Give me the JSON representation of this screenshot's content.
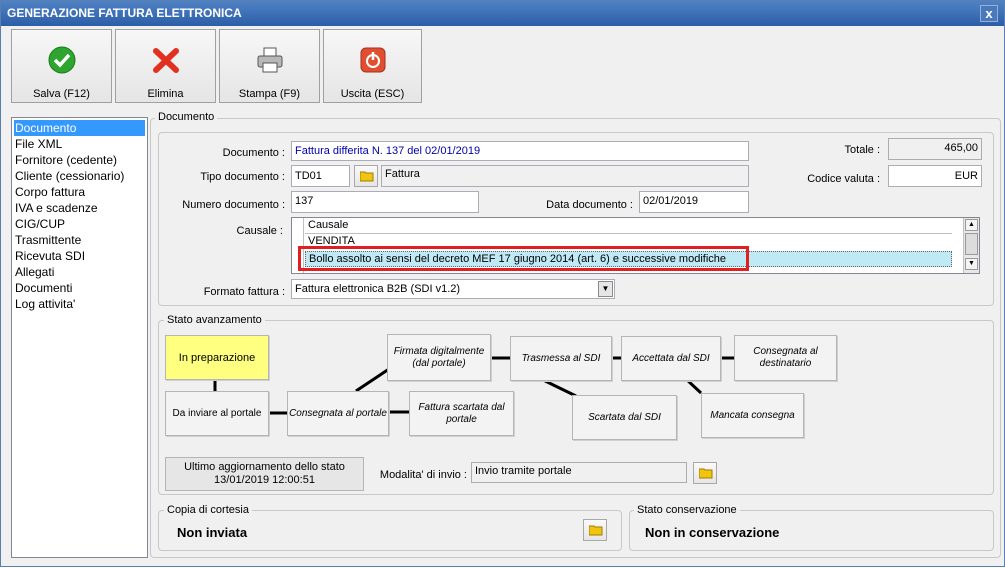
{
  "window": {
    "title": "GENERAZIONE FATTURA ELETTRONICA",
    "close_label": "x"
  },
  "toolbar": {
    "save_label": "Salva (F12)",
    "delete_label": "Elimina",
    "print_label": "Stampa (F9)",
    "exit_label": "Uscita (ESC)"
  },
  "nav": {
    "items": [
      "Documento",
      "File XML",
      "Fornitore (cedente)",
      "Cliente (cessionario)",
      "Corpo fattura",
      "IVA e scadenze",
      "CIG/CUP",
      "Trasmittente",
      "Ricevuta SDI",
      "Allegati",
      "Documenti",
      "Log attivita'"
    ],
    "selected": 0
  },
  "documento": {
    "section_title": "Documento",
    "documento_label": "Documento :",
    "documento_value": "Fattura differita N. 137 del 02/01/2019",
    "tipo_label": "Tipo documento :",
    "tipo_code": "TD01",
    "tipo_desc": "Fattura",
    "numero_label": "Numero documento :",
    "numero_value": "137",
    "data_label": "Data documento :",
    "data_value": "02/01/2019",
    "totale_label": "Totale :",
    "totale_value": "465,00",
    "valuta_label": "Codice valuta :",
    "valuta_value": "EUR",
    "causale_label": "Causale :",
    "causale_header": "Causale",
    "causale_rows": [
      "VENDITA",
      "Bollo assolto ai sensi del decreto MEF 17 giugno 2014 (art. 6) e successive modifiche"
    ],
    "formato_label": "Formato fattura :",
    "formato_value": "Fattura elettronica B2B (SDI v1.2)"
  },
  "stato": {
    "section_title": "Stato avanzamento",
    "boxes": {
      "in_preparazione": "In preparazione",
      "da_inviare": "Da inviare al portale",
      "consegnata_portale": "Consegnata al portale",
      "firmata": "Firmata digitalmente (dal portale)",
      "fattura_scartata": "Fattura scartata dal portale",
      "trasmessa": "Trasmessa al SDI",
      "scartata_sdi": "Scartata dal SDI",
      "accettata": "Accettata dal SDI",
      "mancata": "Mancata consegna",
      "consegnata_dest": "Consegnata al destinatario"
    },
    "ultimo_label": "Ultimo aggiornamento dello stato",
    "ultimo_value": "13/01/2019 12:00:51",
    "modalita_label": "Modalita' di invio :",
    "modalita_value": "Invio tramite portale"
  },
  "copia": {
    "section_title": "Copia di cortesia",
    "value": "Non inviata"
  },
  "conservazione": {
    "section_title": "Stato conservazione",
    "value": "Non in conservazione"
  },
  "colors": {
    "title_bar": "#2c5ea8",
    "active_state": "#ffff80",
    "highlight": "#e02020",
    "selection": "#3399ff"
  }
}
